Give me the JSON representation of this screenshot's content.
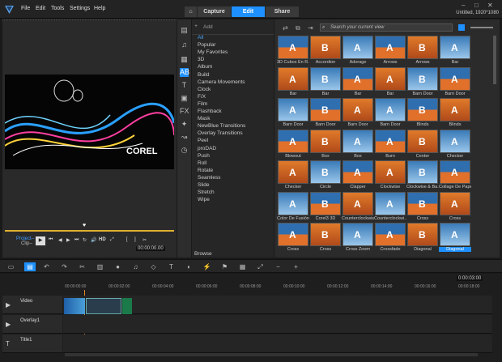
{
  "app": {
    "title_right": "Untitled, 1920*1080"
  },
  "menu": [
    "File",
    "Edit",
    "Tools",
    "Settings",
    "Help"
  ],
  "tabs": [
    "Capture",
    "Edit",
    "Share"
  ],
  "preview": {
    "project_label": "Project–",
    "clip_label": "Clip–",
    "hd_label": "HD",
    "timecode": "00:00:00.00"
  },
  "library": {
    "add_label": "Add",
    "search_placeholder": "Search your current view",
    "browse_label": "Browse",
    "categories": [
      "All",
      "Popular",
      "My Favorites",
      "3D",
      "Album",
      "Build",
      "Camera Movements",
      "Clock",
      "F/X",
      "Film",
      "Flashback",
      "Mask",
      "NewBlue Transitions",
      "Overlay Transitions",
      "Peel",
      "proDAD",
      "Push",
      "Roll",
      "Rotate",
      "Seamless",
      "Slide",
      "Stretch",
      "Wipe"
    ],
    "items": [
      "3D Cubos En R...",
      "Accordion",
      "Adorage",
      "Arrows",
      "Arrows",
      "Bar",
      "Bar",
      "Bar",
      "Bar",
      "Bar",
      "Barn Door",
      "Barn Door",
      "Barn Door",
      "Barn Door",
      "Barn Door",
      "Barn Door",
      "Blinds",
      "Blinds",
      "Blowout",
      "Box",
      "Box",
      "Burn",
      "Center",
      "Checker",
      "Checker",
      "Circle",
      "Clapper",
      "Clockwise",
      "Clockwise & Ba...",
      "Collage De Papel",
      "Color De Fusión",
      "Corel3 3D",
      "Counterclockwise",
      "Counterclockwi...",
      "Cross",
      "Cross",
      "Cross",
      "Cross",
      "Cross Zoom",
      "Crossfade",
      "Diagonal",
      "Diagonal"
    ]
  },
  "timeline": {
    "timecode": "0:00:03:00",
    "ticks": [
      "00:00:00:00",
      "00:00:02:00",
      "00:00:04:00",
      "00:00:06:00",
      "00:00:08:00",
      "00:00:10:00",
      "00:00:12:00",
      "00:00:14:00",
      "00:00:16:00",
      "00:00:18:00"
    ],
    "tracks": [
      "Video",
      "Overlay1",
      "Title1"
    ]
  },
  "colors": {
    "accent": "#1e90ff",
    "bg": "#1a1a1a",
    "playhead": "#e08a2a"
  }
}
